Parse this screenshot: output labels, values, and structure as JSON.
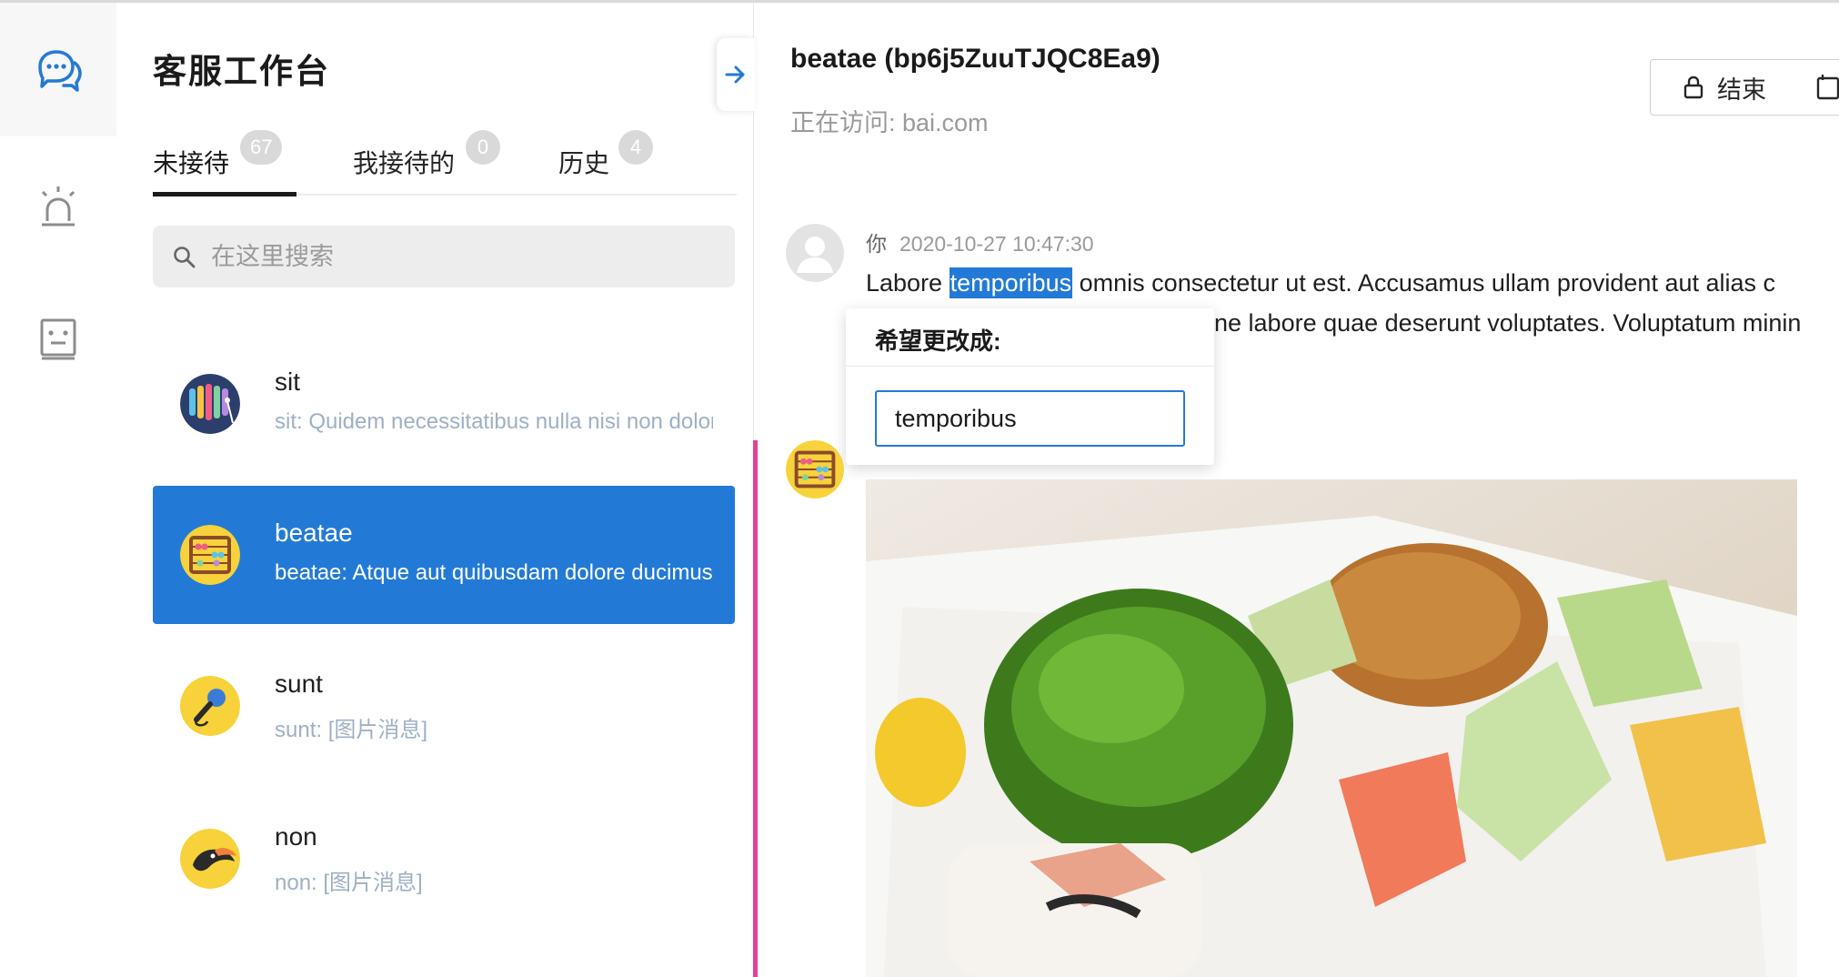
{
  "rail": {
    "items": [
      {
        "icon": "chat-bubbles-icon",
        "active": true
      },
      {
        "icon": "alarm-light-icon",
        "active": false
      },
      {
        "icon": "robot-face-icon",
        "active": false
      }
    ]
  },
  "panel": {
    "title": "客服工作台",
    "tabs": [
      {
        "label": "未接待",
        "count": "67",
        "active": true
      },
      {
        "label": "我接待的",
        "count": "0",
        "active": false
      },
      {
        "label": "历史",
        "count": "4",
        "active": false
      }
    ],
    "search_placeholder": "在这里搜索",
    "conversations": [
      {
        "name": "sit",
        "preview": "sit: Quidem necessitatibus nulla nisi non dolore",
        "avatar": "xylophone-avatar-icon",
        "selected": false
      },
      {
        "name": "beatae",
        "preview": "beatae: Atque aut quibusdam dolore ducimus",
        "avatar": "abacus-avatar-icon",
        "selected": true
      },
      {
        "name": "sunt",
        "preview": "sunt: [图片消息]",
        "avatar": "microphone-avatar-icon",
        "selected": false
      },
      {
        "name": "non",
        "preview": "non: [图片消息]",
        "avatar": "toucan-avatar-icon",
        "selected": false
      }
    ]
  },
  "chat": {
    "title": "beatae (bp6j5ZuuTJQC8Ea9)",
    "subtitle": "正在访问: bai.com",
    "end_button_label": "结束",
    "message1": {
      "sender": "你",
      "timestamp": "2020-10-27 10:47:30",
      "line1_before": "Labore ",
      "line1_highlight": "temporibus",
      "line1_after": " omnis consectetur ut est. Accusamus ullam provident aut alias c",
      "line2": "ne labore quae deserunt voluptates. Voluptatum minin"
    },
    "popover": {
      "title": "希望更改成:",
      "input_value": "temporibus"
    },
    "message2": {
      "image_alt": "food box photo"
    }
  },
  "colors": {
    "accent": "#237ad6",
    "highlight_bar": "#e53f9a",
    "badge": "#d9d9d9"
  }
}
